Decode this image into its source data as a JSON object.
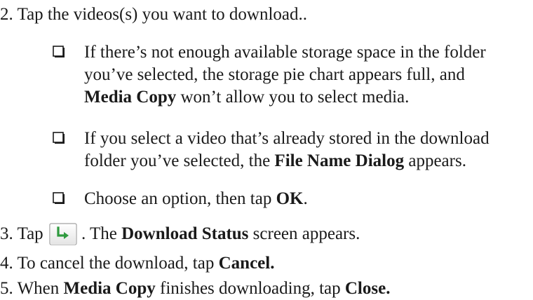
{
  "doc": {
    "step2": {
      "number": "2.",
      "text": "Tap the videos(s) you want to download.."
    },
    "bullets": [
      {
        "line1": "If there’s not enough available storage space in the folder",
        "line2": "you’ve selected, the storage pie chart appears full, and",
        "bold3": "Media Copy",
        "line3": " won’t allow you to select media."
      },
      {
        "line1": "If you select a video that’s already stored in the download",
        "line2_pre": "folder you’ve selected, the ",
        "bold2": "File Name Dialog",
        "line2_post": " appears."
      },
      {
        "line1_pre": "Choose an option, then tap ",
        "bold1": "OK",
        "line1_post": "."
      }
    ],
    "step3": {
      "number": "3.",
      "pre": "Tap",
      "icon": "download-arrow-icon",
      "post": ". The ",
      "bold": "Download Status",
      "post2": " screen appears."
    },
    "step4": {
      "number": "4.",
      "pre": "To cancel the download, tap ",
      "bold": "Cancel."
    },
    "step5": {
      "number": "5.",
      "pre": "When ",
      "bold1": "Media Copy",
      "mid": " finishes downloading, tap ",
      "bold2": "Close."
    }
  }
}
